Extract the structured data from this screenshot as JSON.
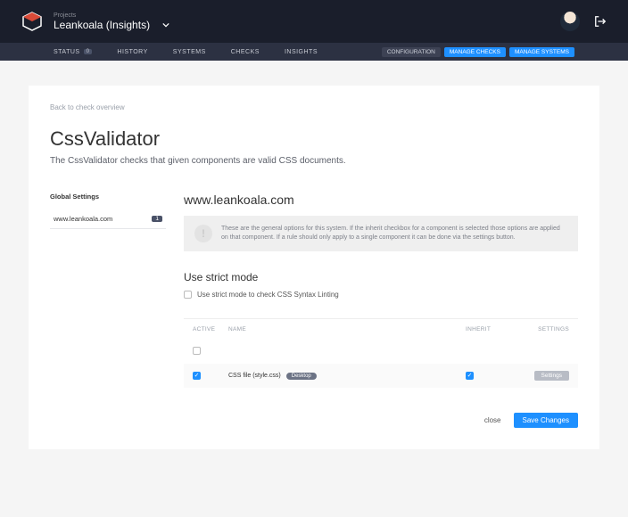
{
  "top": {
    "projects_label": "Projects",
    "project_name": "Leankoala (Insights)"
  },
  "nav": {
    "items": [
      {
        "label": "STATUS",
        "badge": "0"
      },
      {
        "label": "HISTORY"
      },
      {
        "label": "SYSTEMS"
      },
      {
        "label": "CHECKS"
      },
      {
        "label": "INSIGHTS"
      }
    ],
    "config": "CONFIGURATION",
    "manage_checks": "MANAGE CHECKS",
    "manage_systems": "MANAGE SYSTEMS"
  },
  "page": {
    "backlink": "Back to check overview",
    "title": "CssValidator",
    "subtitle": "The CssValidator checks that given components are valid CSS documents."
  },
  "sidebar": {
    "heading": "Global Settings",
    "items": [
      {
        "label": "www.leankoala.com",
        "count": "1"
      }
    ]
  },
  "main": {
    "host": "www.leankoala.com",
    "info": "These are the general options for this system. If the inherit checkbox for a component is selected those options are applied on that component. If a rule should only apply to a single component it can be done via the settings button.",
    "strict_heading": "Use strict mode",
    "strict_label": "Use strict mode to check CSS Syntax Linting",
    "table": {
      "headers": {
        "active": "ACTIVE",
        "name": "NAME",
        "inherit": "INHERIT",
        "settings": "SETTINGS"
      },
      "rows": [
        {
          "active": true,
          "name": "CSS file (style.css)",
          "tag": "Desktop",
          "inherit": true,
          "settings": "Settings"
        }
      ]
    }
  },
  "footer": {
    "close": "close",
    "save": "Save Changes"
  }
}
